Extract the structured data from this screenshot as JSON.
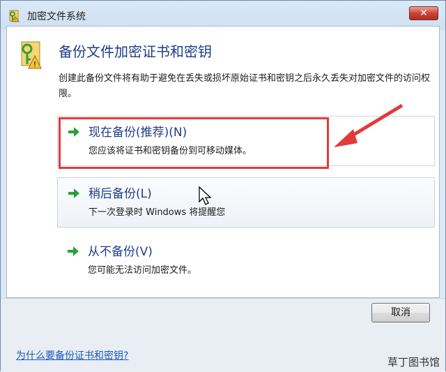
{
  "window": {
    "title": "加密文件系统",
    "close_label": "✕"
  },
  "content": {
    "heading": "备份文件加密证书和密钥",
    "description": "创建此备份文件将有助于避免在丢失或损坏原始证书和密钥之后永久丢失对加密文件的访问权限。",
    "options": [
      {
        "title": "现在备份(推荐)(N)",
        "subtitle": "您应该将证书和密钥备份到可移动媒体。"
      },
      {
        "title": "稍后备份(L)",
        "subtitle": "下一次登录时 Windows 将提醒您"
      },
      {
        "title": "从不备份(V)",
        "subtitle": "您可能无法访问加密文件。"
      }
    ]
  },
  "footer": {
    "cancel_label": "取消",
    "help_link": "为什么要备份证书和密钥?"
  },
  "watermark": "草丁图书馆",
  "colors": {
    "accent": "#1f3c87",
    "highlight": "#e23b3b",
    "arrow": "#2aa03a",
    "link": "#1a59b8"
  },
  "icons": {
    "title": "key-lock-icon",
    "arrow": "green-arrow-icon",
    "cursor": "mouse-pointer-icon"
  }
}
